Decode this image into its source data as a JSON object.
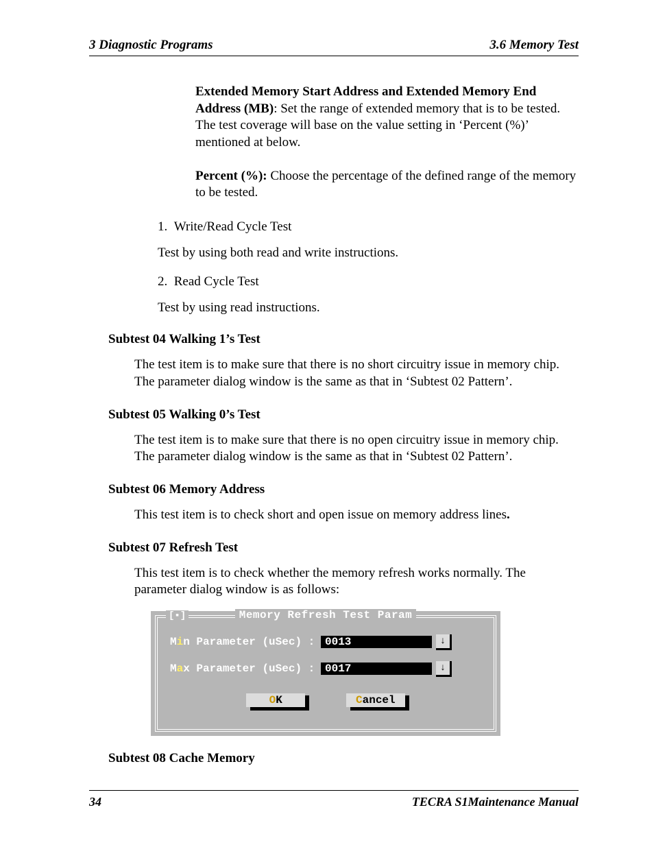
{
  "header": {
    "left": "3  Diagnostic Programs",
    "right": "3.6 Memory Test"
  },
  "para_ext_mem": {
    "bold_lead": "Extended Memory Start Address and Extended Memory End Address (MB)",
    "rest": ": Set the range of extended memory that is to be tested. The test coverage will base on the value setting in ‘Percent (%)’ mentioned at below."
  },
  "para_percent": {
    "bold_lead": "Percent (%):",
    "rest": " Choose the percentage of the defined range of the memory to be tested."
  },
  "num_items": [
    {
      "num": "1.",
      "title": "Write/Read Cycle Test",
      "body": "Test by using both read and write instructions."
    },
    {
      "num": "2.",
      "title": "Read Cycle Test",
      "body": "Test by using read instructions."
    }
  ],
  "subtests": {
    "s04": {
      "title": "Subtest 04  Walking 1’s Test",
      "body": "The test item is to make sure that there is no short circuitry issue in memory chip. The parameter dialog window is the same as that in ‘Subtest 02 Pattern’."
    },
    "s05": {
      "title": "Subtest 05  Walking 0’s Test",
      "body": "The test item is to make sure that there is no open circuitry issue in memory chip. The parameter dialog window is the same as that in ‘Subtest 02 Pattern’."
    },
    "s06": {
      "title": "Subtest 06  Memory Address",
      "body_prefix": "This test item is to check short and open issue on memory address lines",
      "body_bold_period": "."
    },
    "s07": {
      "title": "Subtest 07  Refresh Test",
      "body": "This test item is to check whether the memory refresh works normally. The parameter dialog window is as follows:"
    },
    "s08": {
      "title": "Subtest 08  Cache Memory"
    }
  },
  "dialog": {
    "title": "Memory Refresh Test Param",
    "close_glyph": "[▪]",
    "rows": [
      {
        "hot": "i",
        "pre": "M",
        "post": "n Parameter (uSec) :",
        "value": "0013"
      },
      {
        "hot": "a",
        "pre": "M",
        "post": "x Parameter (uSec)  :",
        "value": "0017"
      }
    ],
    "buttons": {
      "ok": {
        "hot": "O",
        "rest": "K"
      },
      "cancel": {
        "hot": "C",
        "rest": "ancel"
      }
    },
    "spin_glyph": "↓"
  },
  "footer": {
    "page": "34",
    "manual": "TECRA S1Maintenance Manual"
  }
}
